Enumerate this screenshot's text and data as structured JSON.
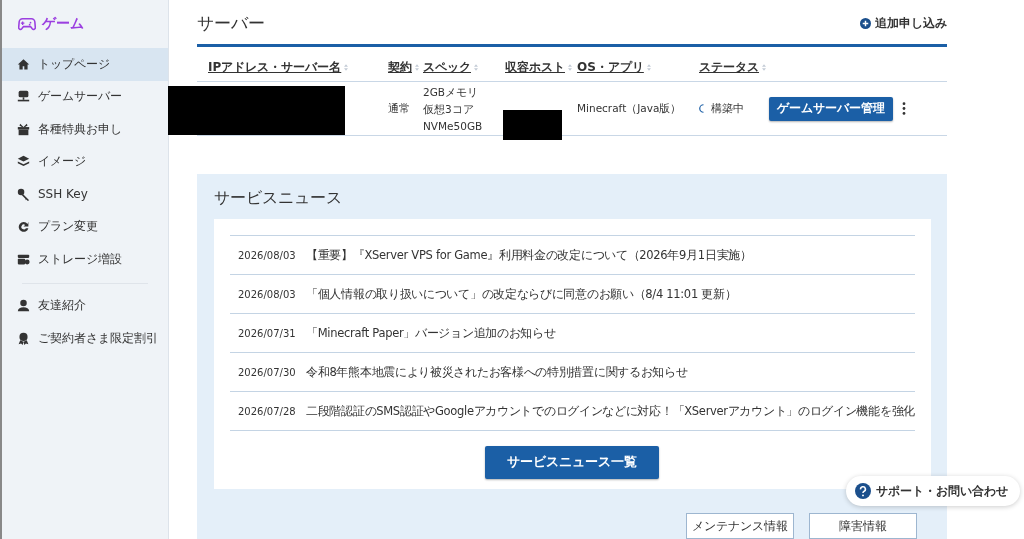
{
  "app": {
    "title": "ゲーム"
  },
  "sidebar": {
    "items": [
      {
        "label": "トップページ",
        "kind": "home",
        "selected": true
      },
      {
        "label": "ゲームサーバー",
        "kind": "server",
        "selected": false
      },
      {
        "label": "各種特典お申し",
        "kind": "gift",
        "selected": false
      },
      {
        "label": "イメージ",
        "kind": "layers",
        "selected": false
      },
      {
        "label": "SSH Key",
        "kind": "key",
        "selected": false
      },
      {
        "label": "プラン変更",
        "kind": "refresh",
        "selected": false
      },
      {
        "label": "ストレージ増設",
        "kind": "storage",
        "selected": false
      }
    ],
    "secondary_items": [
      {
        "label": "友達紹介",
        "kind": "friends",
        "selected": false
      },
      {
        "label": "ご契約者さま限定割引",
        "kind": "badge",
        "selected": false
      }
    ]
  },
  "server_section": {
    "title": "サーバー",
    "add_link": "追加申し込み",
    "columns": [
      "IPアドレス・サーバー名",
      "契約",
      "スペック",
      "収容ホスト",
      "OS・アプリ",
      "ステータス"
    ],
    "rows": [
      {
        "contract": "通常",
        "spec": [
          "2GBメモリ",
          "仮想3コア",
          "NVMe50GB"
        ],
        "os_app": "Minecraft（Java版）",
        "status": "構築中",
        "action": "ゲームサーバー管理"
      }
    ]
  },
  "news": {
    "title": "サービスニュース",
    "items": [
      {
        "date": "2026/08/03",
        "text": "【重要】『XServer VPS for Game』利用料金の改定について（2026年9月1日実施）"
      },
      {
        "date": "2026/08/03",
        "text": "「個人情報の取り扱いについて」の改定ならびに同意のお願い（8/4 11:01 更新）"
      },
      {
        "date": "2026/07/31",
        "text": "「Minecraft Paper」バージョン追加のお知らせ"
      },
      {
        "date": "2026/07/30",
        "text": "令和8年熊本地震により被災されたお客様への特別措置に関するお知らせ"
      },
      {
        "date": "2026/07/28",
        "text": "二段階認証のSMS認証やGoogleアカウントでのログインなどに対応！「XServerアカウント」のログイン機能を強化"
      }
    ],
    "all_button": "サービスニュース一覧",
    "links": [
      "メンテナンス情報",
      "障害情報"
    ]
  },
  "support_button": "サポート・お問い合わせ"
}
